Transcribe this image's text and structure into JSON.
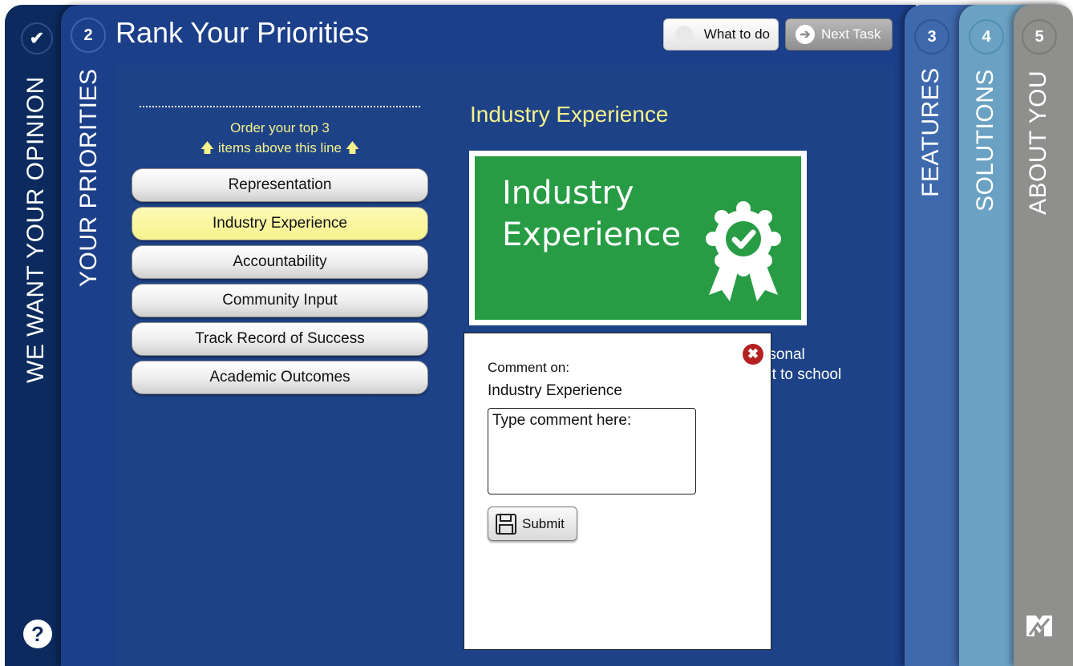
{
  "tabs": {
    "opinion": {
      "number_icon": "check-icon",
      "label": "WE WANT YOUR OPINION",
      "help_label": "?"
    },
    "priorities": {
      "number": "2",
      "label": "YOUR PRIORITIES",
      "title": "Rank Your Priorities"
    },
    "features": {
      "number": "3",
      "label": "FEATURES"
    },
    "solutions": {
      "number": "4",
      "label": "SOLUTIONS"
    },
    "about": {
      "number": "5",
      "label": "ABOUT YOU"
    }
  },
  "header": {
    "what_to_do_label": "What to do",
    "next_task_label": "Next Task"
  },
  "ranking": {
    "instruction_line1": "Order your top 3",
    "instruction_line2": "items above this line",
    "items": [
      {
        "label": "Representation",
        "selected": false
      },
      {
        "label": "Industry Experience",
        "selected": true
      },
      {
        "label": "Accountability",
        "selected": false
      },
      {
        "label": "Community Input",
        "selected": false
      },
      {
        "label": "Track Record of Success",
        "selected": false
      },
      {
        "label": "Academic Outcomes",
        "selected": false
      }
    ]
  },
  "detail": {
    "title": "Industry Experience",
    "image_line1": "Industry",
    "image_line2": "Experience",
    "description_line1": "rsonal",
    "description_line2": "nt to school"
  },
  "comment_dialog": {
    "label": "Comment on:",
    "subject": "Industry Experience",
    "placeholder": "Type comment here:",
    "submit_label": "Submit"
  },
  "colors": {
    "dark_navy": "#0d2a5e",
    "main_blue": "#1c3f8a",
    "highlight_yellow": "#f4f28a",
    "image_green": "#279c44",
    "features_blue": "#3f69ad",
    "solutions_blue": "#6ba2c4",
    "about_gray": "#8f8f8d"
  }
}
